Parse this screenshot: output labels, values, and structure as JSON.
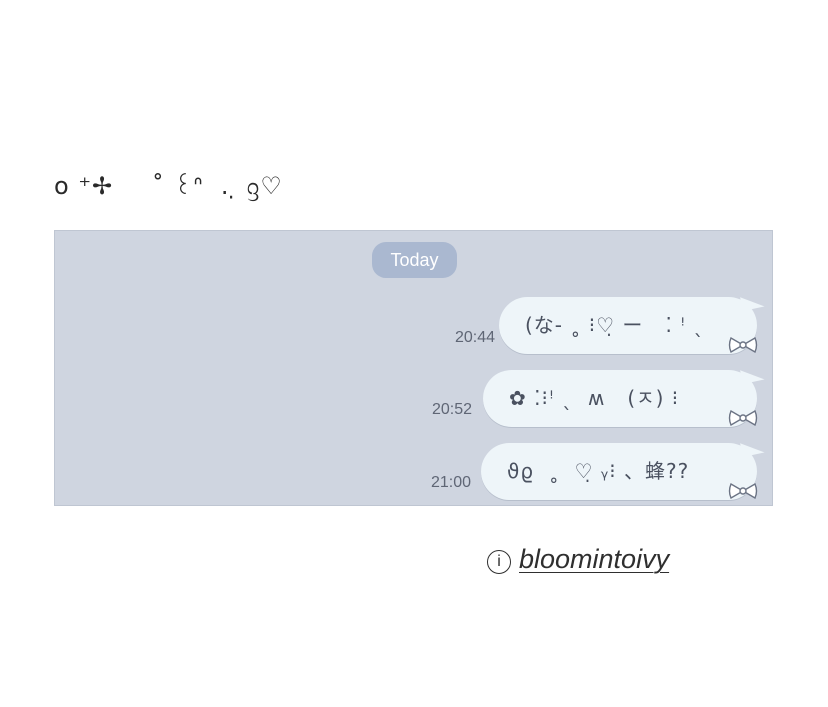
{
  "heading": {
    "text": "o ⁺✢      ̊ ꒰ᐢ  . ̣ ᦋ♡"
  },
  "chat": {
    "date_label": "Today",
    "messages": [
      {
        "time": "20:44",
        "text": "(な- ˳ ⁝♡̣ ー   ⁚ ꜝ ˎ"
      },
      {
        "time": "20:52",
        "text": "✿ ⁚⁝ꜝ ˎ  ʍ   (ㅈ) ⁝"
      },
      {
        "time": "21:00",
        "text": "ϑϱ  ˳  ♡̣ ᵧ⁝ 、蜂??"
      }
    ],
    "colors": {
      "background": "#cfd5e0",
      "bubble": "#eef5f9",
      "date_pill": "#aab8d0"
    },
    "bubble_decoration_icon": "bow-icon"
  },
  "footer": {
    "info_glyph": "i",
    "handle": "bloomintoivy"
  }
}
